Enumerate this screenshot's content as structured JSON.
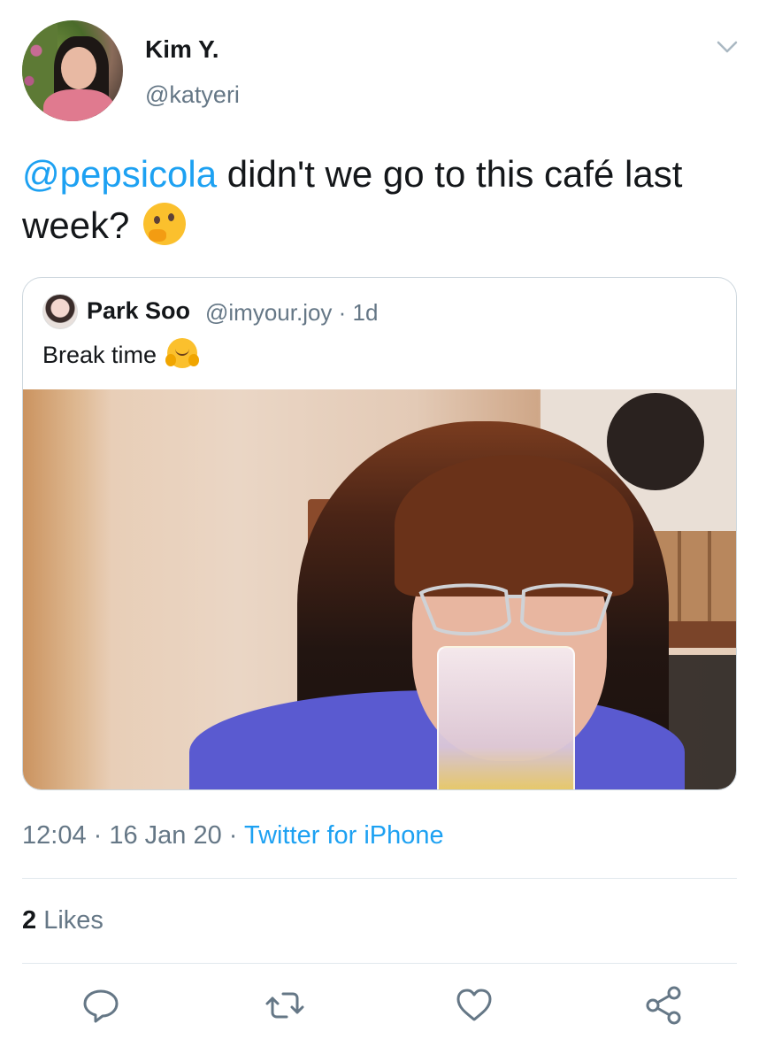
{
  "author": {
    "display_name": "Kim Y.",
    "handle": "@katyeri"
  },
  "tweet": {
    "mention": "@pepsicola",
    "text": " didn't we go to this café last week? "
  },
  "quoted_tweet": {
    "display_name": "Park Soo",
    "handle": "@imyour.joy · 1d",
    "text": "Break time "
  },
  "meta": {
    "time": "12:04",
    "date": "16 Jan 20",
    "separator": " · ",
    "source": "Twitter for iPhone"
  },
  "stats": {
    "likes_count": "2",
    "likes_label": " Likes"
  },
  "actions": {
    "reply": "reply-icon",
    "retweet": "retweet-icon",
    "like": "heart-icon",
    "share": "share-icon"
  },
  "colors": {
    "link": "#1da1f2",
    "secondary_text": "#657786",
    "primary_text": "#14171a",
    "divider": "#e1e8ed"
  }
}
